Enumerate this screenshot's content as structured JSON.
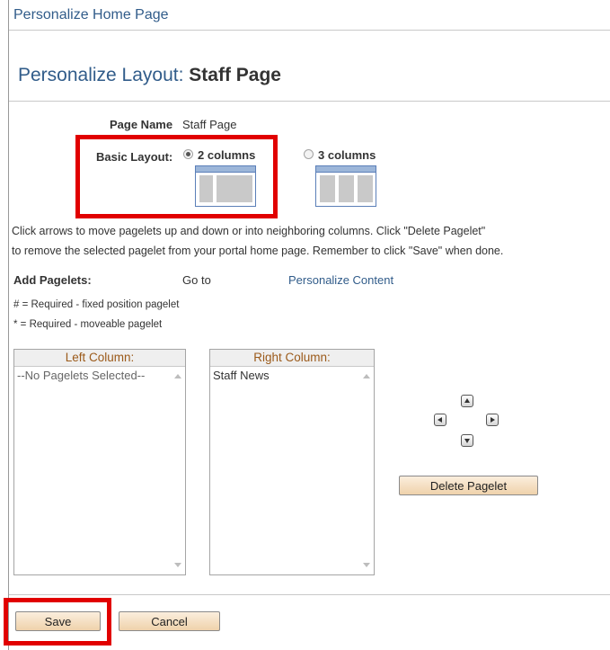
{
  "header": {
    "title": "Personalize Home Page"
  },
  "page": {
    "title_prefix": "Personalize Layout:",
    "title_name": "Staff Page"
  },
  "page_name": {
    "label": "Page Name",
    "value": "Staff Page"
  },
  "basic_layout": {
    "label": "Basic Layout:",
    "options": [
      {
        "label": "2 columns",
        "selected": true
      },
      {
        "label": "3 columns",
        "selected": false
      }
    ]
  },
  "instructions": {
    "line1": "Click arrows to move pagelets up and down or into neighboring columns. Click \"Delete Pagelet\"",
    "line2": "to remove the selected pagelet from your portal home page. Remember to click \"Save\" when done."
  },
  "add_pagelets": {
    "label": "Add Pagelets:",
    "goto": "Go to",
    "link": "Personalize Content"
  },
  "legend": {
    "fixed": "# = Required - fixed position pagelet",
    "moveable": "* = Required - moveable pagelet"
  },
  "left_column": {
    "header": "Left Column:",
    "items": [
      "--No Pagelets Selected--"
    ]
  },
  "right_column": {
    "header": "Right Column:",
    "items": [
      "Staff News"
    ]
  },
  "move_controls": [
    "arrow-up-icon",
    "arrow-left-icon",
    "arrow-right-icon",
    "arrow-down-icon"
  ],
  "buttons": {
    "delete": "Delete Pagelet",
    "save": "Save",
    "cancel": "Cancel"
  },
  "colors": {
    "highlight": "#e10000",
    "link": "#315c8a",
    "column_header": "#9b5a1a",
    "button_bg": "#f5dfc0"
  }
}
